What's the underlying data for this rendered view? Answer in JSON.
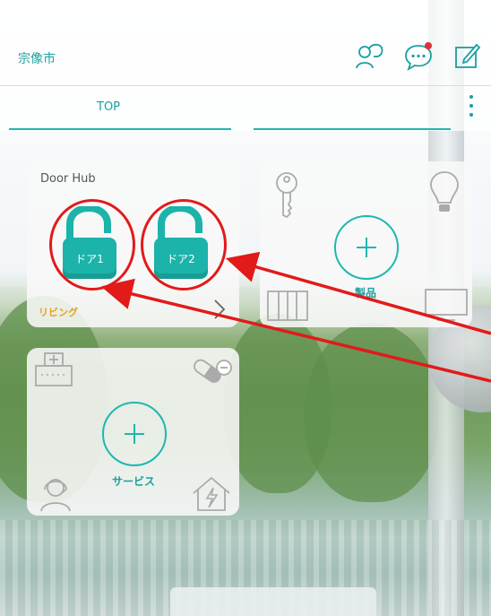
{
  "header": {
    "city": "宗像市",
    "icons": [
      "support-chat-icon",
      "message-icon",
      "edit-icon"
    ],
    "notification_dot_color": "#e0303a"
  },
  "tabs": {
    "items": [
      {
        "label": "TOP"
      },
      {
        "label": ""
      }
    ],
    "accent_color": "#1fb7b0"
  },
  "cards": {
    "door_hub": {
      "title": "Door Hub",
      "locks": [
        {
          "label": "ドア1"
        },
        {
          "label": "ドア2"
        }
      ],
      "room": "リビング"
    },
    "products": {
      "label": "製品",
      "icons": [
        "key-icon",
        "lightbulb-icon",
        "window-icon",
        "tv-icon"
      ]
    },
    "services": {
      "label": "サービス",
      "icons": [
        "hospital-icon",
        "pill-icon",
        "support-headset-icon",
        "house-power-icon"
      ]
    }
  },
  "annotations": {
    "highlight_color": "#e21a1a"
  }
}
